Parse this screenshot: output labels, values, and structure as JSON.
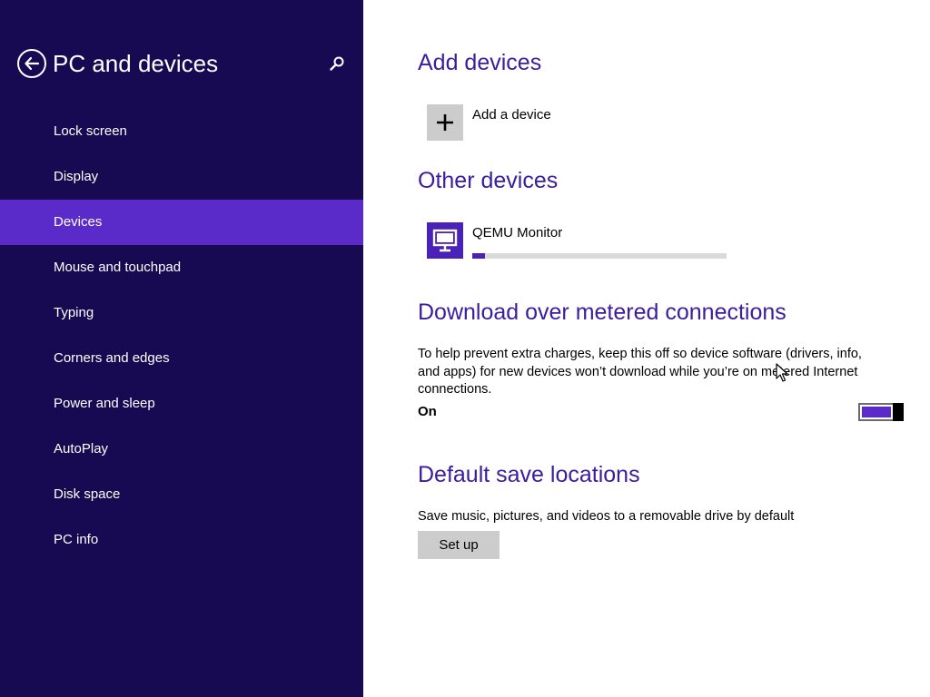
{
  "sidebar": {
    "title": "PC and devices",
    "back_icon": "back-arrow-circle-icon",
    "search_icon": "search-icon",
    "items": [
      {
        "label": "Lock screen",
        "selected": false
      },
      {
        "label": "Display",
        "selected": false
      },
      {
        "label": "Devices",
        "selected": true
      },
      {
        "label": "Mouse and touchpad",
        "selected": false
      },
      {
        "label": "Typing",
        "selected": false
      },
      {
        "label": "Corners and edges",
        "selected": false
      },
      {
        "label": "Power and sleep",
        "selected": false
      },
      {
        "label": "AutoPlay",
        "selected": false
      },
      {
        "label": "Disk space",
        "selected": false
      },
      {
        "label": "PC info",
        "selected": false
      }
    ]
  },
  "main": {
    "add_devices": {
      "title": "Add devices",
      "add_label": "Add a device",
      "icon": "plus-icon"
    },
    "other_devices": {
      "title": "Other devices",
      "device_name": "QEMU Monitor",
      "device_icon": "monitor-icon",
      "progress_fraction": 0.05
    },
    "metered": {
      "title": "Download over metered connections",
      "description": "To help prevent extra charges, keep this off so device software (drivers, info, and apps) for new devices won’t download while you’re on metered Internet connections.",
      "state_label": "On",
      "toggle_on": true
    },
    "save_locations": {
      "title": "Default save locations",
      "description": "Save music, pictures, and videos to a removable drive by default",
      "button_label": "Set up"
    }
  },
  "colors": {
    "sidebar_bg": "#180a52",
    "selected_bg": "#5b2bc9",
    "accent": "#4a22b8",
    "heading": "#3b1d9e"
  }
}
